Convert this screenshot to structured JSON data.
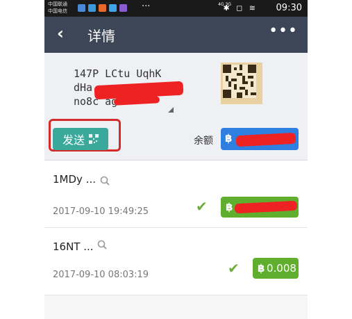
{
  "status_bar": {
    "carrier_1": "中国联通",
    "carrier_2": "中国电信",
    "more": "···",
    "icons": "✱ ◻ ≋",
    "network": "4G 3G",
    "time": "09:30"
  },
  "header": {
    "back_icon": "‹",
    "title": "详情",
    "more_icon": "•••"
  },
  "wallet": {
    "address_lines": [
      "147P LCtu UqhK",
      "dHa",
      "no8c agF"
    ],
    "send_label": "发送",
    "balance_label": "余额",
    "currency_symbol": "฿"
  },
  "transactions": [
    {
      "id": "1MDy ...",
      "date": "2017-09-10 19:49:25",
      "amount": ""
    },
    {
      "id": "16NT ...",
      "date": "2017-09-10 08:03:19",
      "amount": "0.008"
    }
  ],
  "colors": {
    "header_bg": "#3d4656",
    "send_button": "#3aa89a",
    "balance_button": "#2f7fe0",
    "amount_green": "#5fae2e",
    "check_green": "#6cae3a",
    "highlight_red": "#d62b2b"
  }
}
